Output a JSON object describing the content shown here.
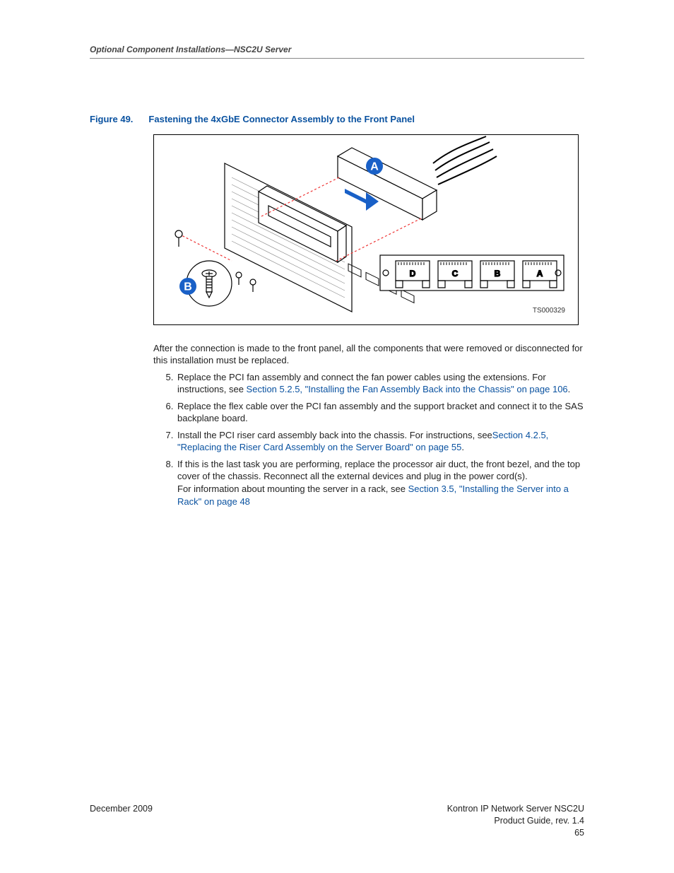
{
  "header": {
    "running_head": "Optional Component Installations—NSC2U Server"
  },
  "figure": {
    "label": "Figure 49.",
    "title": "Fastening the 4xGbE Connector Assembly to the Front Panel",
    "callouts": {
      "a": "A",
      "b": "B"
    },
    "ports": {
      "d": "D",
      "c": "C",
      "b": "B",
      "a": "A"
    },
    "ts": "TS000329"
  },
  "body": {
    "intro": "After the connection is made to the front panel, all the components that were removed or disconnected for this installation must be replaced.",
    "steps": {
      "s5a": "Replace the PCI fan assembly and connect the fan power cables using the extensions. For instructions, see ",
      "s5link": "Section 5.2.5, \"Installing the Fan Assembly Back into the Chassis\" on page 106",
      "s5b": ".",
      "s6": "Replace the flex cable over the PCI fan assembly and the support bracket and connect it to the SAS backplane board.",
      "s7a": "Install the PCI riser card assembly back into the chassis. For instructions, see",
      "s7link": "Section 4.2.5, \"Replacing the Riser Card Assembly on the Server Board\" on page 55",
      "s7b": ".",
      "s8a": "If this is the last task you are performing, replace the processor air duct, the front bezel, and the top cover of the chassis. Reconnect all the external devices and plug in the power cord(s).",
      "s8b": "For information about mounting the server in a rack, see ",
      "s8link": "Section 3.5, \"Installing the Server into a Rack\" on page 48"
    }
  },
  "footer": {
    "date": "December 2009",
    "line1": "Kontron IP Network Server NSC2U",
    "line2": "Product Guide, rev. 1.4",
    "page": "65"
  }
}
